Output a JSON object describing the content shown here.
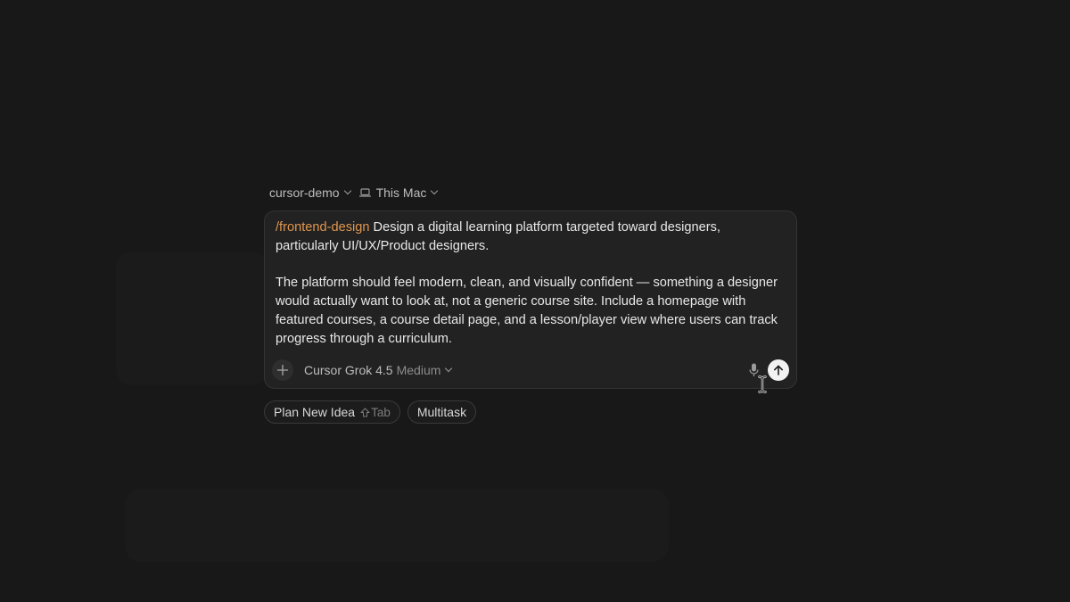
{
  "context": {
    "project": "cursor-demo",
    "environment": "This Mac"
  },
  "composer": {
    "slash_command": "/frontend-design",
    "prompt_text": " Design a digital learning platform targeted toward designers, particularly UI/UX/Product designers.\n\nThe platform should feel modern, clean, and visually confident — something a designer would actually want to look at, not a generic course site. Include a homepage with featured courses, a course detail page, and a lesson/player view where users can track progress through a curriculum.",
    "model_name": "Cursor Grok 4.5",
    "model_effort": "Medium"
  },
  "chips": {
    "plan_label": "Plan New Idea",
    "plan_shortcut": "Tab",
    "multitask_label": "Multitask"
  },
  "icons": {
    "environment": "laptop-icon",
    "attach": "plus-icon",
    "voice": "microphone-icon",
    "send": "arrow-up-icon",
    "shortcut": "shift-icon"
  },
  "colors": {
    "background": "#181818",
    "composer": "#222222",
    "slash_command": "#e0964e",
    "send_button": "#f2f2f2"
  }
}
